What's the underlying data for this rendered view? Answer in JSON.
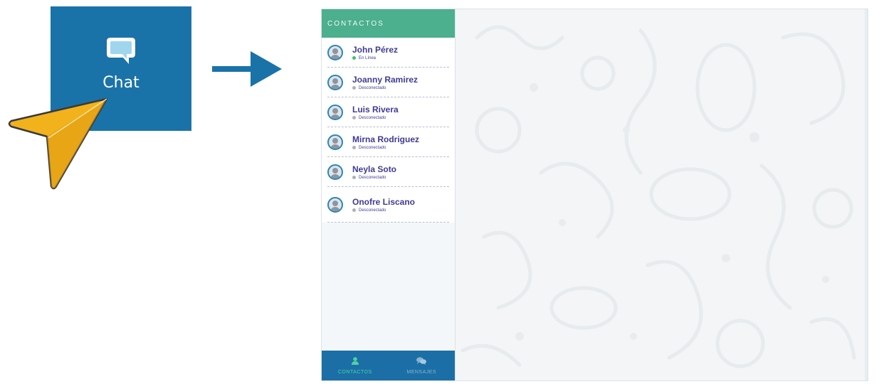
{
  "tile": {
    "label": "Chat",
    "icon": "speech-bubble-icon",
    "color": "#1a73a8"
  },
  "cursor": {
    "icon": "pointer-arrow-icon",
    "color": "#f2b21c"
  },
  "arrow": {
    "icon": "right-arrow-icon",
    "color": "#1a73a8"
  },
  "sidebar": {
    "header": "CONTACTOS",
    "header_color": "#4caf8e",
    "contacts": [
      {
        "name": "John Pérez",
        "status": "En Línea",
        "online": true
      },
      {
        "name": "Joanny Ramirez",
        "status": "Desconectado",
        "online": false
      },
      {
        "name": "Luis Rivera",
        "status": "Desconectado",
        "online": false
      },
      {
        "name": "Mirna Rodriguez",
        "status": "Desconectado",
        "online": false
      },
      {
        "name": "Neyla Soto",
        "status": "Desconectado",
        "online": false
      },
      {
        "name": "Onofre Liscano",
        "status": "Desconectado",
        "online": false
      }
    ],
    "status_colors": {
      "online": "#3cc26b",
      "offline": "#aab2b8"
    },
    "footer": {
      "tabs": [
        {
          "label": "CONTACTOS",
          "icon": "user-icon",
          "active": true
        },
        {
          "label": "MENSAJES",
          "icon": "chat-bubbles-icon",
          "active": false
        }
      ],
      "color": "#1b6fa6"
    }
  }
}
